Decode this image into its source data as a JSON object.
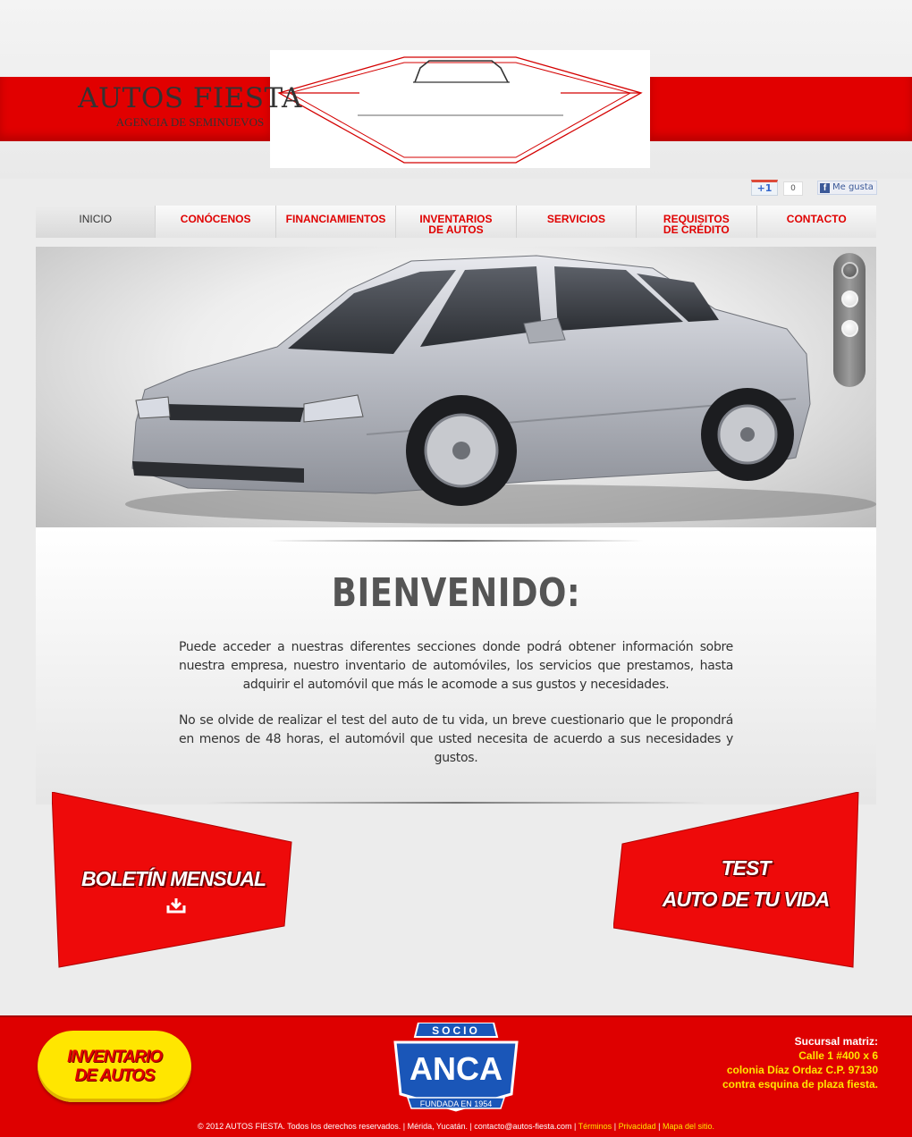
{
  "header": {
    "logo_title": "AUTOS FIESTA",
    "logo_subtitle": "AGENCIA DE SEMINUEVOS"
  },
  "social": {
    "gplus_label": "+1",
    "gplus_count": "0",
    "fb_icon": "f",
    "fb_label": "Me gusta"
  },
  "nav": {
    "items": [
      {
        "label": "INICIO",
        "label2": ""
      },
      {
        "label": "CONÓCENOS",
        "label2": ""
      },
      {
        "label": "FINANCIAMIENTOS",
        "label2": ""
      },
      {
        "label": "INVENTARIOS",
        "label2": "DE AUTOS"
      },
      {
        "label": "SERVICIOS",
        "label2": ""
      },
      {
        "label": "REQUISITOS",
        "label2": "DE CRÉDITO"
      },
      {
        "label": "CONTACTO",
        "label2": ""
      }
    ]
  },
  "welcome": {
    "title": "BIENVENIDO:",
    "p1": "Puede acceder a nuestras diferentes secciones donde podrá obtener información sobre nuestra empresa, nuestro inventario de automóviles, los servicios que prestamos, hasta adquirir el automóvil que más le acomode a sus gustos y necesidades.",
    "p2": "No se olvide de realizar el test del auto de tu vida, un breve cuestionario que le propondrá en menos de 48 horas, el automóvil que usted necesita de acuerdo a sus necesidades y gustos."
  },
  "callouts": {
    "boletin": "BOLETÍN MENSUAL",
    "test_line1": "TEST",
    "test_line2": "AUTO DE TU VIDA"
  },
  "footer": {
    "inventario_line1": "INVENTARIO",
    "inventario_line2": "DE AUTOS",
    "anca_top": "SOCIO",
    "anca_main": "ANCA",
    "anca_bottom": "FUNDADA EN 1954",
    "address_label": "Sucursal matriz:",
    "address_1": "Calle 1 #400 x 6",
    "address_2": "colonia Díaz Ordaz  C.P. 97130",
    "address_3": "contra esquina de plaza fiesta.",
    "copyright": "© 2012 AUTOS FIESTA. Todos los derechos reservados. | Mérida, Yucatán. | contacto@autos-fiesta.com |",
    "link_terminos": "Términos",
    "link_privacidad": "Privacidad",
    "link_mapa": "Mapa del sitio."
  },
  "colors": {
    "brand_red": "#e10000",
    "accent_yellow": "#ffe600",
    "anca_blue": "#1a56b8"
  }
}
